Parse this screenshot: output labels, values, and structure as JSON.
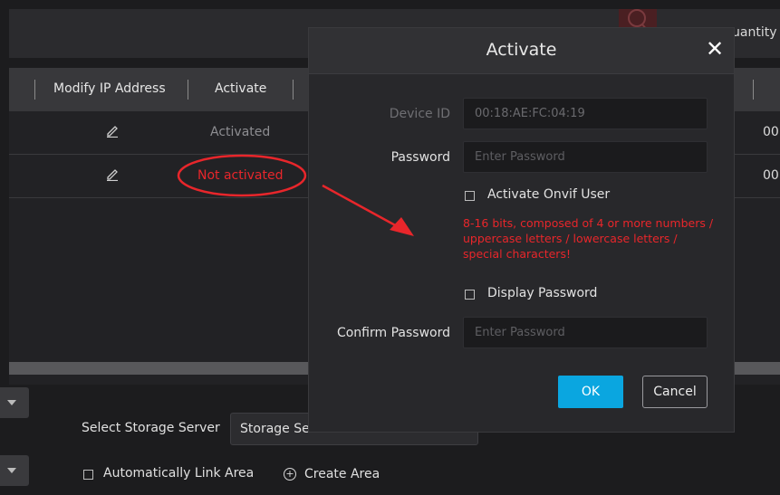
{
  "window": {
    "quantity_label": "uantity"
  },
  "table": {
    "headers": {
      "modify_ip": "Modify IP Address",
      "activate": "Activate"
    },
    "rows": [
      {
        "status": "Activated",
        "trailing": "00"
      },
      {
        "status": "Not activated",
        "trailing": "00"
      }
    ]
  },
  "bottom": {
    "storage_label": "Select Storage Server",
    "storage_value": "Storage Server",
    "auto_link_label": "Automatically Link Area",
    "create_area_label": "Create Area"
  },
  "dialog": {
    "title": "Activate",
    "device_id_label": "Device ID",
    "device_id_value": "00:18:AE:FC:04:19",
    "password_label": "Password",
    "password_placeholder": "Enter Password",
    "onvif_label": "Activate Onvif User",
    "warning": "8-16 bits, composed of 4 or more numbers / uppercase letters / lowercase letters / special characters!",
    "display_password_label": "Display Password",
    "confirm_label": "Confirm Password",
    "confirm_placeholder": "Enter Password",
    "ok_label": "OK",
    "cancel_label": "Cancel"
  },
  "colors": {
    "accent": "#0aa6e0",
    "warning": "#e8262b",
    "background": "#1c1c1e"
  },
  "icons": [
    "search-icon",
    "close-icon",
    "edit-icon",
    "chevron-down-icon",
    "plus-circle-icon",
    "arrow-annotation"
  ]
}
